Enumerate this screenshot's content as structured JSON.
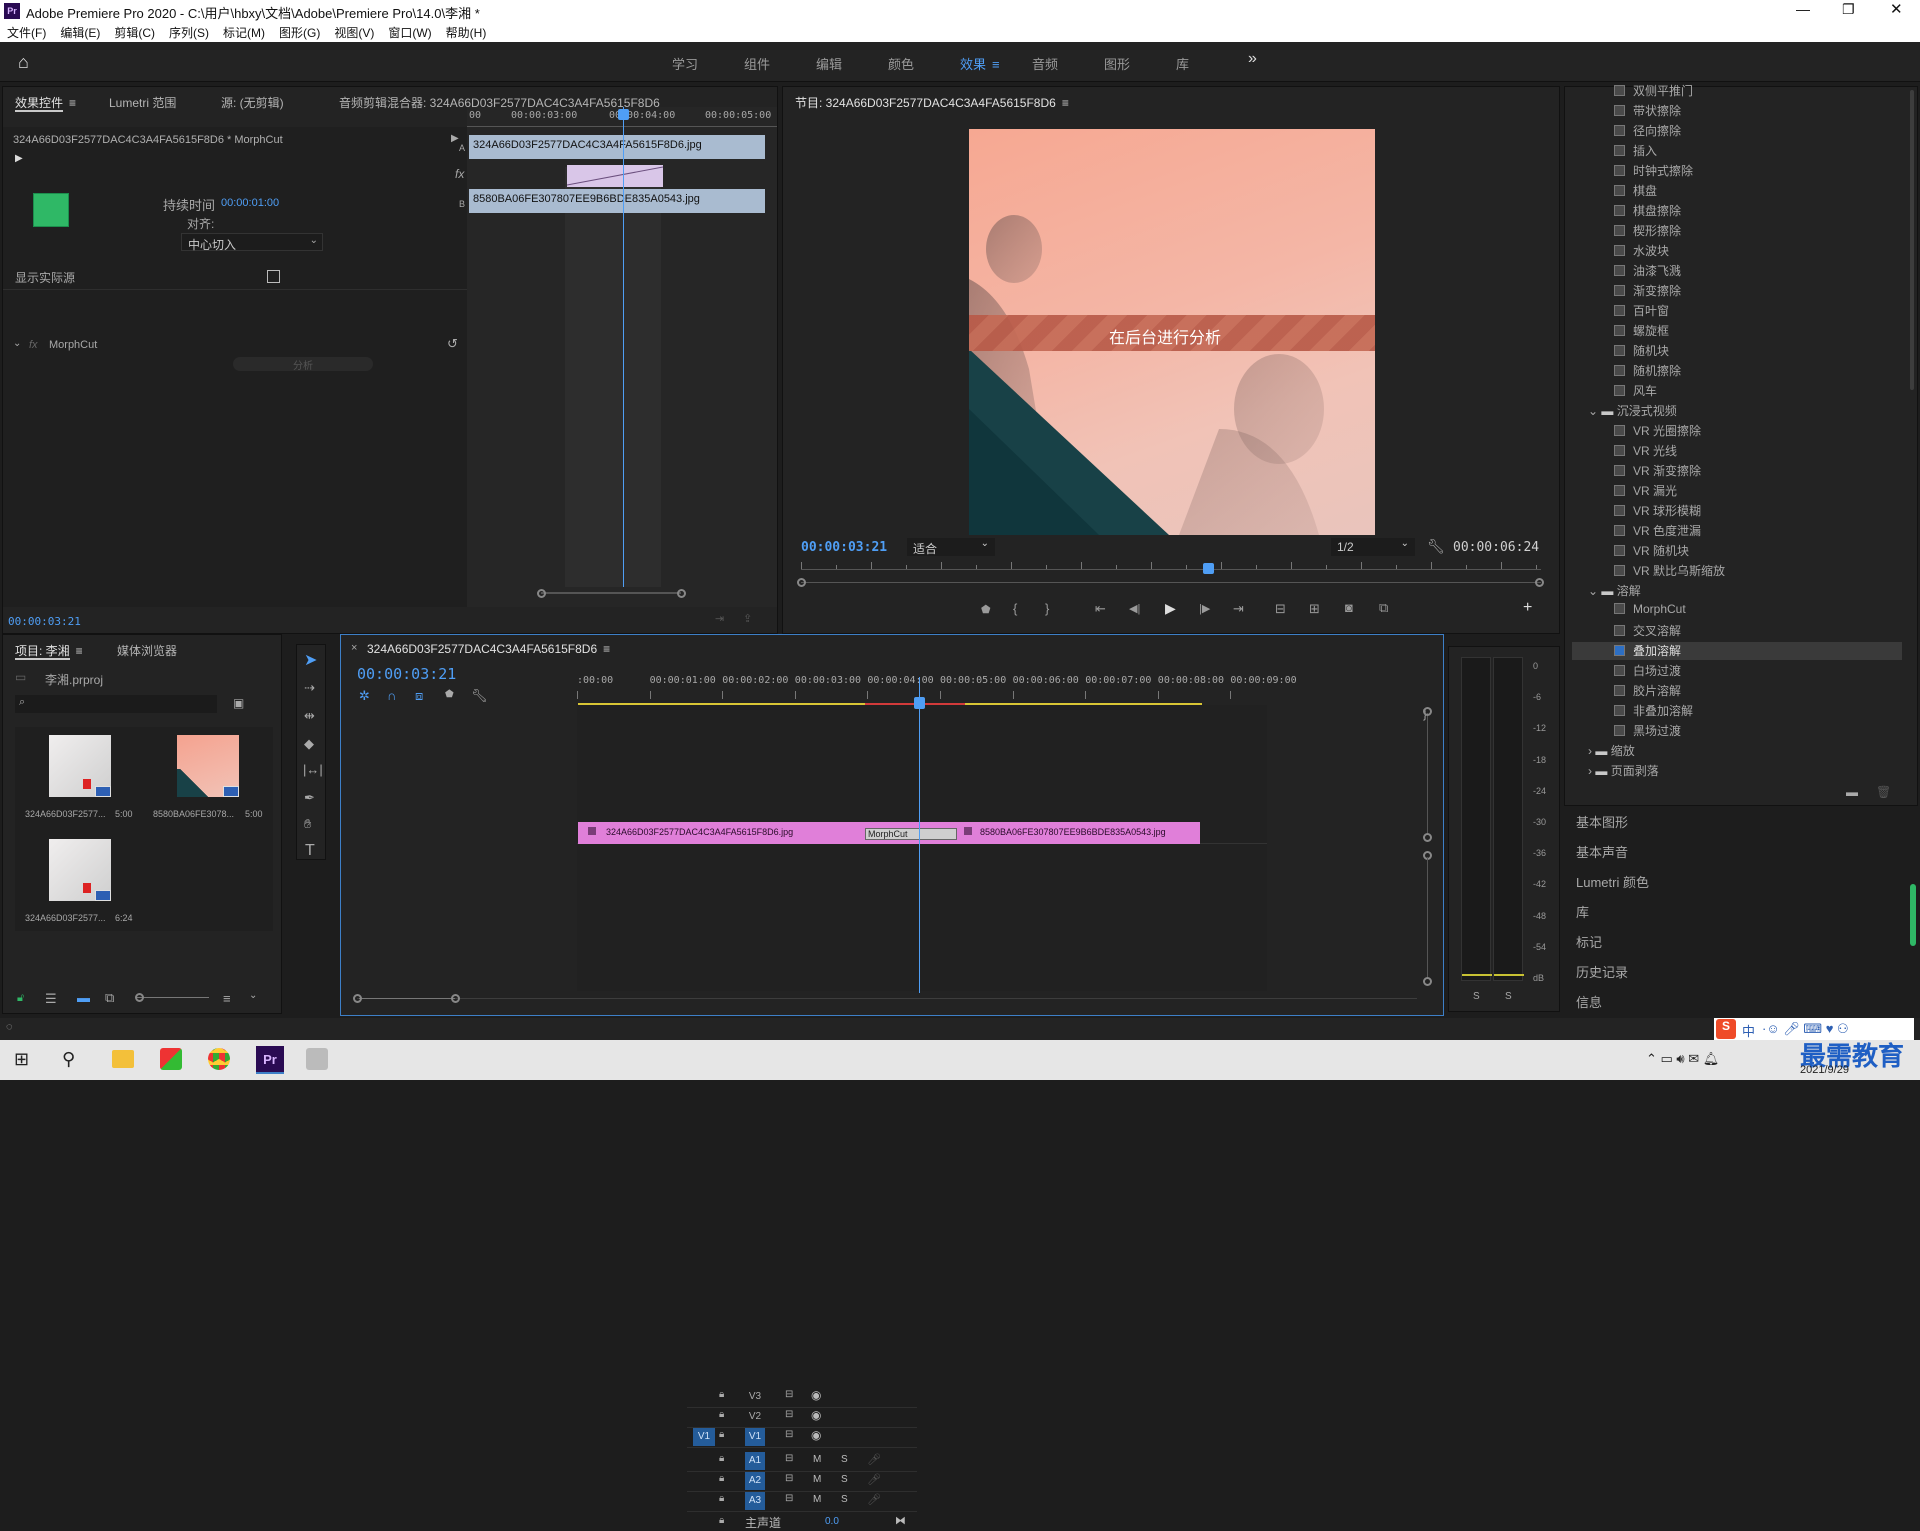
{
  "window": {
    "title": "Adobe Premiere Pro 2020 - C:\\用户\\hbxy\\文档\\Adobe\\Premiere Pro\\14.0\\李湘 *",
    "app_icon": "Pr"
  },
  "menu": [
    "文件(F)",
    "编辑(E)",
    "剪辑(C)",
    "序列(S)",
    "标记(M)",
    "图形(G)",
    "视图(V)",
    "窗口(W)",
    "帮助(H)"
  ],
  "workspaces": [
    "学习",
    "组件",
    "编辑",
    "颜色",
    "效果",
    "音频",
    "图形",
    "库"
  ],
  "workspace_active": "效果",
  "workspace_more": "»",
  "effect_controls": {
    "tabs": [
      "效果控件",
      "Lumetri 范围",
      "源: (无剪辑)",
      "音频剪辑混合器: 324A66D03F2577DAC4C3A4FA5615F8D6"
    ],
    "clip_header": "324A66D03F2577DAC4C3A4FA5615F8D6 * MorphCut",
    "duration_label": "持续时间",
    "duration_value": "00:00:01:00",
    "align_label": "对齐:",
    "align_value": "中心切入",
    "show_actual_label": "显示实际源",
    "effect_name": "MorphCut",
    "analyze_label": "分析",
    "ruler_ticks": [
      "00",
      "00:00:03:00",
      "00:00:04:00",
      "00:00:05:00"
    ],
    "clip_a": "324A66D03F2577DAC4C3A4FA5615F8D6.jpg",
    "clip_b": "8580BA06FE307807EE9B6BDE835A0543.jpg",
    "track_a": "A",
    "track_b": "B",
    "fx_label": "fx",
    "timecode": "00:00:03:21"
  },
  "program_monitor": {
    "title": "节目: 324A66D03F2577DAC4C3A4FA5615F8D6",
    "overlay_text": "在后台进行分析",
    "timecode": "00:00:03:21",
    "zoom": "适合",
    "resolution": "1/2",
    "duration": "00:00:06:24",
    "playhead_fraction": 0.55
  },
  "effects_panel": {
    "items_top": [
      "双侧平推门",
      "带状擦除",
      "径向擦除",
      "插入",
      "时钟式擦除",
      "棋盘",
      "棋盘擦除",
      "楔形擦除",
      "水波块",
      "油漆飞溅",
      "渐变擦除",
      "百叶窗",
      "螺旋框",
      "随机块",
      "随机擦除",
      "风车"
    ],
    "folder_immersive": "沉浸式视频",
    "items_vr": [
      "VR 光圈擦除",
      "VR 光线",
      "VR 渐变擦除",
      "VR 漏光",
      "VR 球形模糊",
      "VR 色度泄漏",
      "VR 随机块",
      "VR 默比乌斯缩放"
    ],
    "folder_dissolve": "溶解",
    "items_dissolve": [
      "MorphCut",
      "交叉溶解",
      "叠加溶解",
      "白场过渡",
      "胶片溶解",
      "非叠加溶解",
      "黑场过渡"
    ],
    "selected_item": "叠加溶解",
    "folder_zoom": "缩放",
    "folder_page": "页面剥落",
    "side_panels": [
      "基本图形",
      "基本声音",
      "Lumetri 颜色",
      "库",
      "标记",
      "历史记录",
      "信息"
    ]
  },
  "project_panel": {
    "tabs": [
      "项目: 李湘",
      "媒体浏览器"
    ],
    "file": "李湘.prproj",
    "search_placeholder": "",
    "items": [
      {
        "name": "324A66D03F2577...",
        "duration": "5:00"
      },
      {
        "name": "8580BA06FE3078...",
        "duration": "5:00"
      },
      {
        "name": "324A66D03F2577...",
        "duration": "6:24"
      }
    ]
  },
  "timeline": {
    "tab": "324A66D03F2577DAC4C3A4FA5615F8D6",
    "close": "×",
    "timecode": "00:00:03:21",
    "ruler": [
      ":00:00",
      "00:00:01:00",
      "00:00:02:00",
      "00:00:03:00",
      "00:00:04:00",
      "00:00:05:00",
      "00:00:06:00",
      "00:00:07:00",
      "00:00:08:00",
      "00:00:09:00"
    ],
    "video_tracks": [
      "V3",
      "V2",
      "V1"
    ],
    "audio_tracks": [
      "A1",
      "A2",
      "A3"
    ],
    "source_patch_v": "V1",
    "master_label": "主声道",
    "master_value": "0.0",
    "mute": "M",
    "solo": "S",
    "clip1": "324A66D03F2577DAC4C3A4FA5615F8D6.jpg",
    "transition": "MorphCut",
    "clip2": "8580BA06FE307807EE9B6BDE835A0543.jpg"
  },
  "audio_meter": {
    "scale": [
      "0",
      "-6",
      "-12",
      "-18",
      "-24",
      "-30",
      "-36",
      "-42",
      "-48",
      "-54",
      "dB"
    ],
    "solo_labels": [
      "S",
      "S"
    ]
  },
  "taskbar": {
    "time": "2021/9/29",
    "watermark": "最需教育",
    "ime": "中"
  },
  "colors": {
    "accent": "#2d8ceb",
    "clip": "#e07fd9",
    "panel": "#232323"
  }
}
